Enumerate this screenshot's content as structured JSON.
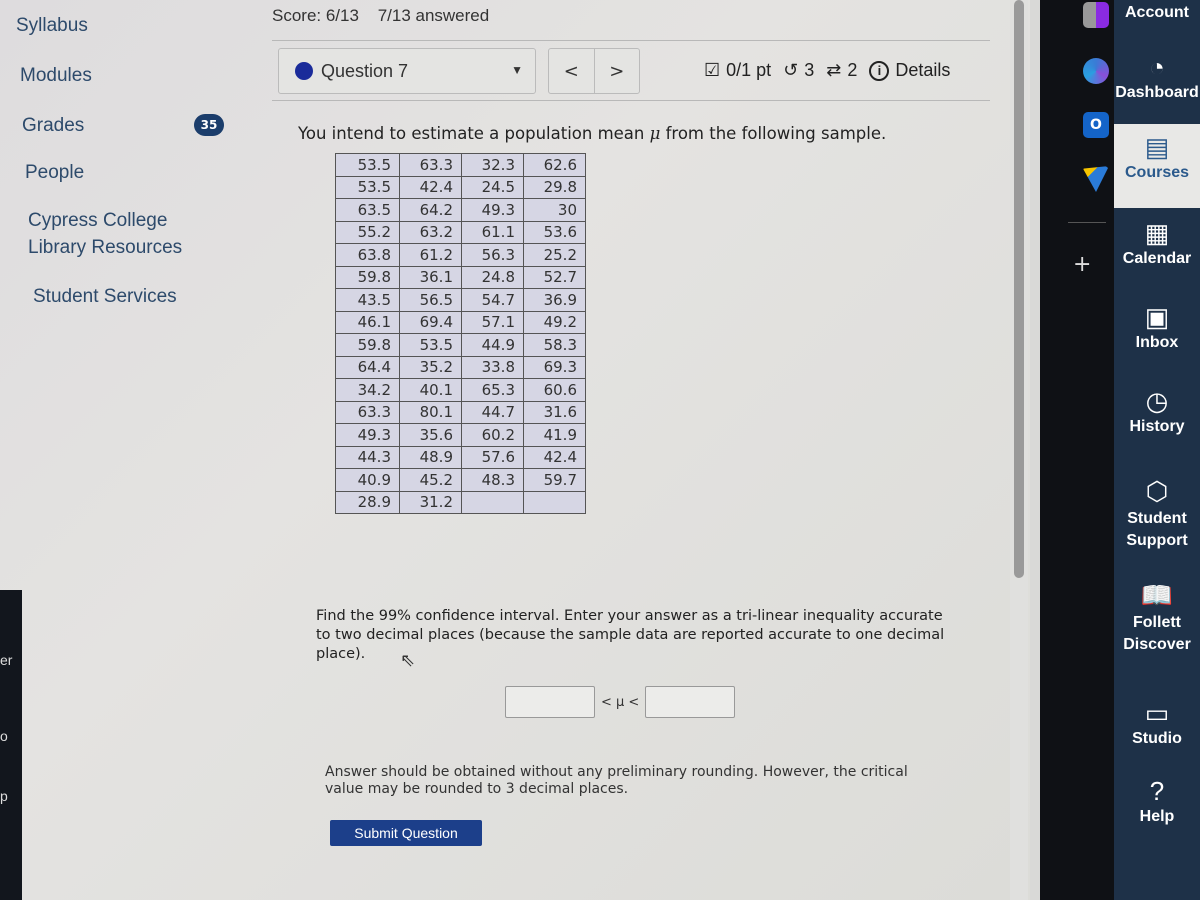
{
  "course_nav": {
    "items": [
      {
        "label": "Syllabus"
      },
      {
        "label": "Modules"
      },
      {
        "label": "Grades",
        "badge": "35"
      },
      {
        "label": "People"
      },
      {
        "label": "Cypress College Library Resources",
        "line1": "Cypress College",
        "line2": "Library Resources"
      },
      {
        "label": "Student Services"
      }
    ]
  },
  "header": {
    "score": "Score: 6/13",
    "answered": "7/13 answered",
    "question_selector": "Question 7",
    "prev": "<",
    "next": ">",
    "points": "0/1 pt",
    "retries": "3",
    "attempts": "2",
    "details": "Details"
  },
  "question": {
    "prompt_before": "You intend to estimate a population mean ",
    "prompt_symbol": "μ",
    "prompt_after": " from the following sample.",
    "sample_table": [
      [
        "53.5",
        "63.3",
        "32.3",
        "62.6"
      ],
      [
        "53.5",
        "42.4",
        "24.5",
        "29.8"
      ],
      [
        "63.5",
        "64.2",
        "49.3",
        "30"
      ],
      [
        "55.2",
        "63.2",
        "61.1",
        "53.6"
      ],
      [
        "63.8",
        "61.2",
        "56.3",
        "25.2"
      ],
      [
        "59.8",
        "36.1",
        "24.8",
        "52.7"
      ],
      [
        "43.5",
        "56.5",
        "54.7",
        "36.9"
      ],
      [
        "46.1",
        "69.4",
        "57.1",
        "49.2"
      ],
      [
        "59.8",
        "53.5",
        "44.9",
        "58.3"
      ],
      [
        "64.4",
        "35.2",
        "33.8",
        "69.3"
      ],
      [
        "34.2",
        "40.1",
        "65.3",
        "60.6"
      ],
      [
        "63.3",
        "80.1",
        "44.7",
        "31.6"
      ],
      [
        "49.3",
        "35.6",
        "60.2",
        "41.9"
      ],
      [
        "44.3",
        "48.9",
        "57.6",
        "42.4"
      ],
      [
        "40.9",
        "45.2",
        "48.3",
        "59.7"
      ],
      [
        "28.9",
        "31.2",
        "",
        ""
      ]
    ],
    "instruction": "Find the 99% confidence interval. Enter your answer as a tri-linear inequality accurate to two decimal places (because the sample data are reported accurate to one decimal place).",
    "inequality_middle": "< μ <",
    "lower_value": "",
    "upper_value": "",
    "note": "Answer should be obtained without any preliminary rounding. However, the critical value may be rounded to 3 decimal places.",
    "submit_label": "Submit Question"
  },
  "global_nav": {
    "items": [
      {
        "label": "Account",
        "icon": "account-icon"
      },
      {
        "label": "Dashboard",
        "icon": "dashboard-icon"
      },
      {
        "label": "Courses",
        "icon": "courses-icon",
        "active": true
      },
      {
        "label": "Calendar",
        "icon": "calendar-icon"
      },
      {
        "label": "Inbox",
        "icon": "inbox-icon"
      },
      {
        "label": "History",
        "icon": "history-icon"
      },
      {
        "label": "Student Support",
        "icon": "student-support-icon"
      },
      {
        "label": "Follett Discover",
        "icon": "follett-discover-icon"
      },
      {
        "label": "Studio",
        "icon": "studio-icon"
      },
      {
        "label": "Help",
        "icon": "help-icon"
      }
    ]
  },
  "left_edge_fragments": [
    "er",
    "o",
    "p"
  ],
  "colors": {
    "nav_text": "#2d4a6b",
    "global_nav_bg": "#1e3148",
    "submit_bg": "#1c3f8a",
    "question_dot": "#1a2b9a",
    "table_bg": "#d6d6e4"
  }
}
